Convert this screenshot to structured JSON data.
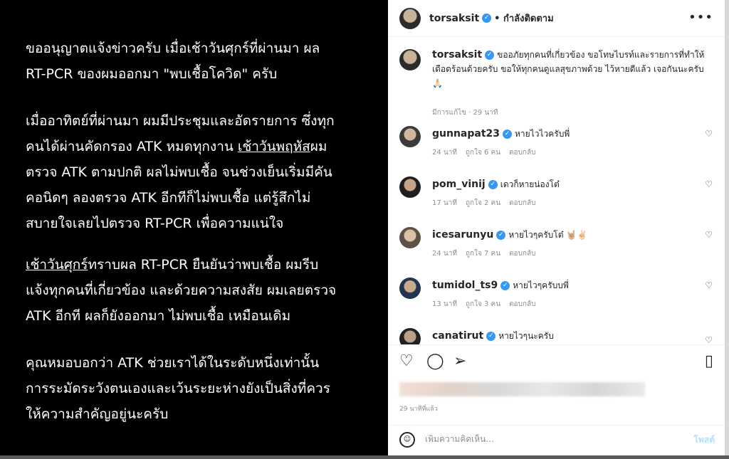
{
  "post_text": {
    "p1": "ขออนุญาตแจ้งข่าวครับ เมื่อเช้าวันศุกร์ที่ผ่านมา ผล\nRT-PCR ของผมออกมา \"พบเชื้อโควิด\" ครับ",
    "p2_a": "เมื่ออาทิตย์ที่ผ่านมา ผมมีประชุมและอัดรายการ ซึ่งทุก\nคนได้ผ่านคัดกรอง ATK หมดทุกงาน ",
    "p2_u": "เช้าวันพฤหัส",
    "p2_b": "ผม\nตรวจ ATK ตามปกติ ผลไม่พบเชื้อ จนช่วงเย็นเริ่มมีคัน\nคอนิดๆ ลองตรวจ ATK อีกทีก็ไม่พบเชื้อ แต่รู้สึกไม่\nสบายใจเลยไปตรวจ RT-PCR เพื่อความแน่ใจ",
    "p3_u": "เช้าวันศุกร์",
    "p3_b": "ทราบผล RT-PCR ยืนยันว่าพบเชื้อ ผมรีบ\nแจ้งทุกคนที่เกี่ยวข้อง และด้วยความสงสัย ผมเลยตรวจ\nATK อีกที ผลก็ยังออกมา ไม่พบเชื้อ เหมือนเดิม",
    "p4": "คุณหมอบอกว่า ATK ช่วยเราได้ในระดับหนึ่งเท่านั้น\nการระมัดระวังตนเองและเว้นระยะห่างยังเป็นสิ่งที่ควร\nให้ความสำคัญอยู่นะครับ"
  },
  "header": {
    "username": "torsaksit",
    "verified_mark": "✓",
    "follow_status": "• กำลังติดตาม",
    "more_icon": "•••"
  },
  "caption": {
    "username": "torsaksit",
    "text": "ขออภัยทุกคนที่เกี่ยวข้อง ขอโทษไบรท์และรายการที่ทำให้เดือดร้อนด้วยครับ ขอให้ทุกคนดูแลสุขภาพด้วย ไว้หายดีแล้ว เจอกันนะครับ 🙏🏻",
    "meta": "มีการแก้ไข · 29 นาที"
  },
  "comments": [
    {
      "username": "gunnapat23",
      "text": "หายไวไวครับพี่",
      "time": "24 นาที",
      "likes": "ถูกใจ 6 คน",
      "reply": "ตอบกลับ"
    },
    {
      "username": "pom_vinij",
      "text": "เดวก็หายน่องโต๋",
      "time": "17 นาที",
      "likes": "ถูกใจ 2 คน",
      "reply": "ตอบกลับ"
    },
    {
      "username": "icesarunyu",
      "text": "หายไวๆครับโต๋ 🤘🏼✌🏻",
      "time": "24 นาที",
      "likes": "ถูกใจ 7 คน",
      "reply": "ตอบกลับ"
    },
    {
      "username": "tumidol_ts9",
      "text": "หายไวๆครับบพี่",
      "time": "13 นาที",
      "likes": "ถูกใจ 3 คน",
      "reply": "ตอบกลับ"
    },
    {
      "username": "canatirut",
      "text": "หายไวๆนะครับ",
      "time": "",
      "likes": "",
      "reply": ""
    }
  ],
  "icons": {
    "heart": "♡",
    "like": "♡",
    "comment": "◯",
    "share": "➢",
    "save": "▯",
    "emoji": "☺"
  },
  "actions": {
    "time_ago": "29 นาทีที่แล้ว"
  },
  "add_comment": {
    "placeholder": "เพิ่มความคิดเห็น...",
    "post_label": "โพสต์"
  }
}
